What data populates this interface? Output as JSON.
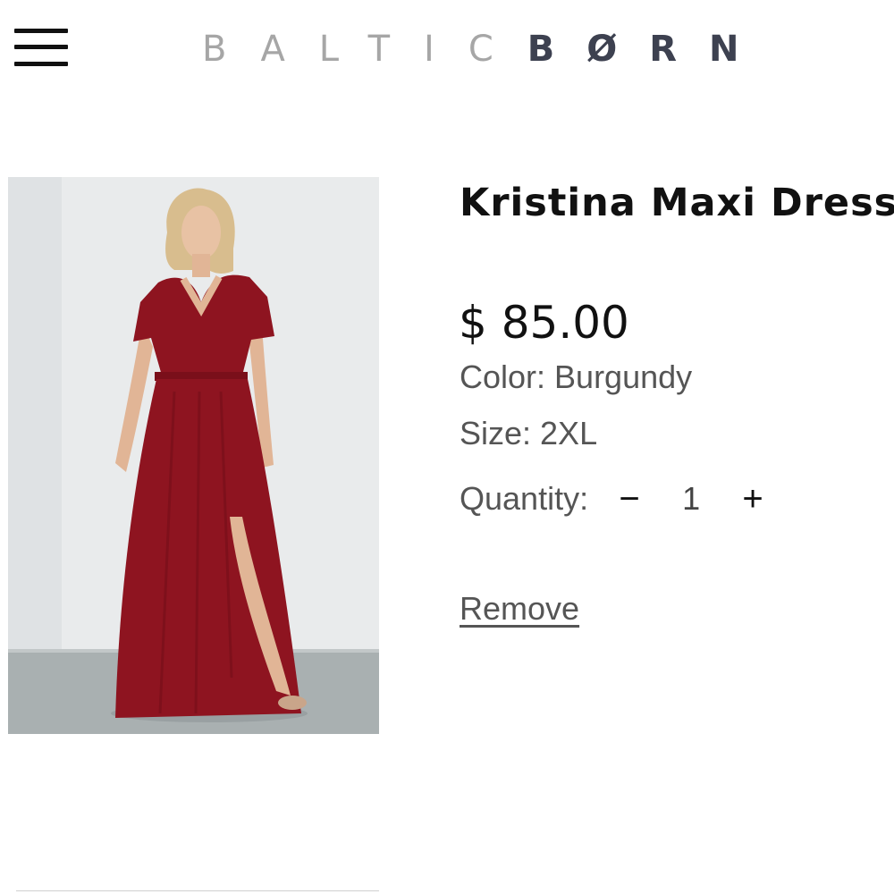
{
  "header": {
    "menu_icon": "hamburger-menu-icon",
    "logo_light": "BALTIC",
    "logo_dark": "BØRN"
  },
  "product": {
    "title": "Kristina Maxi Dress",
    "price": "$ 85.00",
    "color_text": "Color: Burgundy",
    "size_text": "Size: 2XL",
    "quantity_label": "Quantity:",
    "quantity_value": "1",
    "minus_glyph": "−",
    "plus_glyph": "+",
    "remove_label": "Remove",
    "dress_color": "#8e1420"
  }
}
